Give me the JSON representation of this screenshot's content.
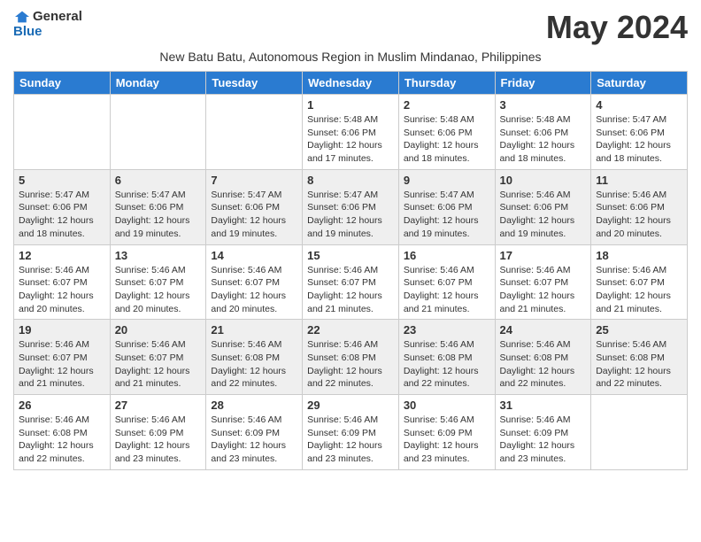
{
  "logo": {
    "general": "General",
    "blue": "Blue"
  },
  "title": "May 2024",
  "subtitle": "New Batu Batu, Autonomous Region in Muslim Mindanao, Philippines",
  "headers": [
    "Sunday",
    "Monday",
    "Tuesday",
    "Wednesday",
    "Thursday",
    "Friday",
    "Saturday"
  ],
  "weeks": [
    [
      {
        "day": "",
        "info": ""
      },
      {
        "day": "",
        "info": ""
      },
      {
        "day": "",
        "info": ""
      },
      {
        "day": "1",
        "info": "Sunrise: 5:48 AM\nSunset: 6:06 PM\nDaylight: 12 hours\nand 17 minutes."
      },
      {
        "day": "2",
        "info": "Sunrise: 5:48 AM\nSunset: 6:06 PM\nDaylight: 12 hours\nand 18 minutes."
      },
      {
        "day": "3",
        "info": "Sunrise: 5:48 AM\nSunset: 6:06 PM\nDaylight: 12 hours\nand 18 minutes."
      },
      {
        "day": "4",
        "info": "Sunrise: 5:47 AM\nSunset: 6:06 PM\nDaylight: 12 hours\nand 18 minutes."
      }
    ],
    [
      {
        "day": "5",
        "info": "Sunrise: 5:47 AM\nSunset: 6:06 PM\nDaylight: 12 hours\nand 18 minutes."
      },
      {
        "day": "6",
        "info": "Sunrise: 5:47 AM\nSunset: 6:06 PM\nDaylight: 12 hours\nand 19 minutes."
      },
      {
        "day": "7",
        "info": "Sunrise: 5:47 AM\nSunset: 6:06 PM\nDaylight: 12 hours\nand 19 minutes."
      },
      {
        "day": "8",
        "info": "Sunrise: 5:47 AM\nSunset: 6:06 PM\nDaylight: 12 hours\nand 19 minutes."
      },
      {
        "day": "9",
        "info": "Sunrise: 5:47 AM\nSunset: 6:06 PM\nDaylight: 12 hours\nand 19 minutes."
      },
      {
        "day": "10",
        "info": "Sunrise: 5:46 AM\nSunset: 6:06 PM\nDaylight: 12 hours\nand 19 minutes."
      },
      {
        "day": "11",
        "info": "Sunrise: 5:46 AM\nSunset: 6:06 PM\nDaylight: 12 hours\nand 20 minutes."
      }
    ],
    [
      {
        "day": "12",
        "info": "Sunrise: 5:46 AM\nSunset: 6:07 PM\nDaylight: 12 hours\nand 20 minutes."
      },
      {
        "day": "13",
        "info": "Sunrise: 5:46 AM\nSunset: 6:07 PM\nDaylight: 12 hours\nand 20 minutes."
      },
      {
        "day": "14",
        "info": "Sunrise: 5:46 AM\nSunset: 6:07 PM\nDaylight: 12 hours\nand 20 minutes."
      },
      {
        "day": "15",
        "info": "Sunrise: 5:46 AM\nSunset: 6:07 PM\nDaylight: 12 hours\nand 21 minutes."
      },
      {
        "day": "16",
        "info": "Sunrise: 5:46 AM\nSunset: 6:07 PM\nDaylight: 12 hours\nand 21 minutes."
      },
      {
        "day": "17",
        "info": "Sunrise: 5:46 AM\nSunset: 6:07 PM\nDaylight: 12 hours\nand 21 minutes."
      },
      {
        "day": "18",
        "info": "Sunrise: 5:46 AM\nSunset: 6:07 PM\nDaylight: 12 hours\nand 21 minutes."
      }
    ],
    [
      {
        "day": "19",
        "info": "Sunrise: 5:46 AM\nSunset: 6:07 PM\nDaylight: 12 hours\nand 21 minutes."
      },
      {
        "day": "20",
        "info": "Sunrise: 5:46 AM\nSunset: 6:07 PM\nDaylight: 12 hours\nand 21 minutes."
      },
      {
        "day": "21",
        "info": "Sunrise: 5:46 AM\nSunset: 6:08 PM\nDaylight: 12 hours\nand 22 minutes."
      },
      {
        "day": "22",
        "info": "Sunrise: 5:46 AM\nSunset: 6:08 PM\nDaylight: 12 hours\nand 22 minutes."
      },
      {
        "day": "23",
        "info": "Sunrise: 5:46 AM\nSunset: 6:08 PM\nDaylight: 12 hours\nand 22 minutes."
      },
      {
        "day": "24",
        "info": "Sunrise: 5:46 AM\nSunset: 6:08 PM\nDaylight: 12 hours\nand 22 minutes."
      },
      {
        "day": "25",
        "info": "Sunrise: 5:46 AM\nSunset: 6:08 PM\nDaylight: 12 hours\nand 22 minutes."
      }
    ],
    [
      {
        "day": "26",
        "info": "Sunrise: 5:46 AM\nSunset: 6:08 PM\nDaylight: 12 hours\nand 22 minutes."
      },
      {
        "day": "27",
        "info": "Sunrise: 5:46 AM\nSunset: 6:09 PM\nDaylight: 12 hours\nand 23 minutes."
      },
      {
        "day": "28",
        "info": "Sunrise: 5:46 AM\nSunset: 6:09 PM\nDaylight: 12 hours\nand 23 minutes."
      },
      {
        "day": "29",
        "info": "Sunrise: 5:46 AM\nSunset: 6:09 PM\nDaylight: 12 hours\nand 23 minutes."
      },
      {
        "day": "30",
        "info": "Sunrise: 5:46 AM\nSunset: 6:09 PM\nDaylight: 12 hours\nand 23 minutes."
      },
      {
        "day": "31",
        "info": "Sunrise: 5:46 AM\nSunset: 6:09 PM\nDaylight: 12 hours\nand 23 minutes."
      },
      {
        "day": "",
        "info": ""
      }
    ]
  ]
}
